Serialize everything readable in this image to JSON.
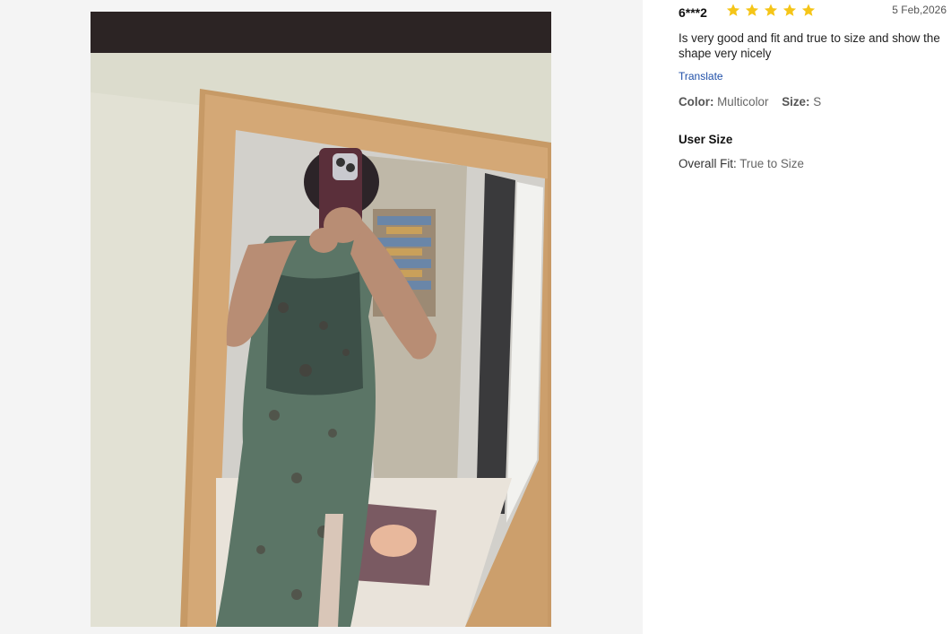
{
  "review": {
    "reviewer": "6***2",
    "rating": 5,
    "date": "5 Feb,2026",
    "text": "Is very good and fit and true to size and show the shape very nicely",
    "translate_label": "Translate",
    "color_label": "Color:",
    "color_value": "Multicolor",
    "size_label": "Size:",
    "size_value": "S",
    "user_size_title": "User Size",
    "overall_fit_label": "Overall Fit:",
    "overall_fit_value": "True to Size"
  },
  "colors": {
    "star": "#f5c518",
    "link": "#1f4fa8",
    "panel_background": "#f4f4f4"
  },
  "icons": {
    "rating": "star-icon"
  }
}
